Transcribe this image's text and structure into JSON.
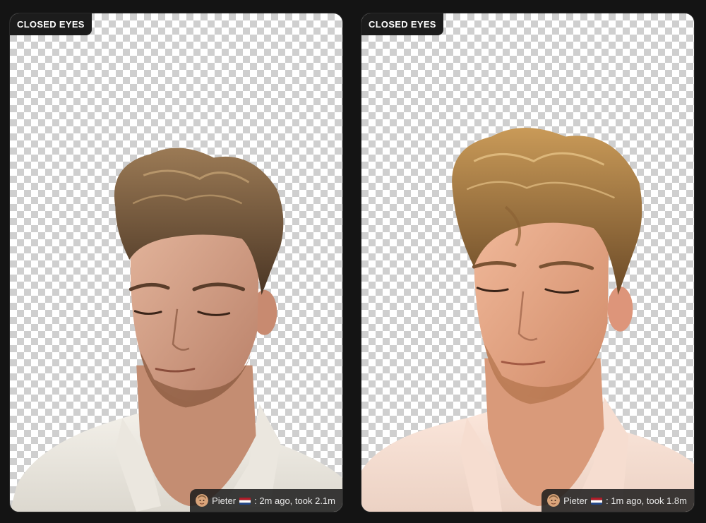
{
  "cards": [
    {
      "tag": "CLOSED EYES",
      "user": "Pieter",
      "flag_icon": "netherlands-flag-icon",
      "time": ": 2m ago, took 2.1m",
      "variant": "cool"
    },
    {
      "tag": "CLOSED EYES",
      "user": "Pieter",
      "flag_icon": "netherlands-flag-icon",
      "time": ": 1m ago, took 1.8m",
      "variant": "warm"
    }
  ],
  "colors": {
    "page_bg": "#141414",
    "tag_bg": "#1c1c1c",
    "checker_dark": "#cfcfcf",
    "checker_light": "#ffffff",
    "flag_red": "#ae1c28",
    "flag_blue": "#21468b"
  }
}
